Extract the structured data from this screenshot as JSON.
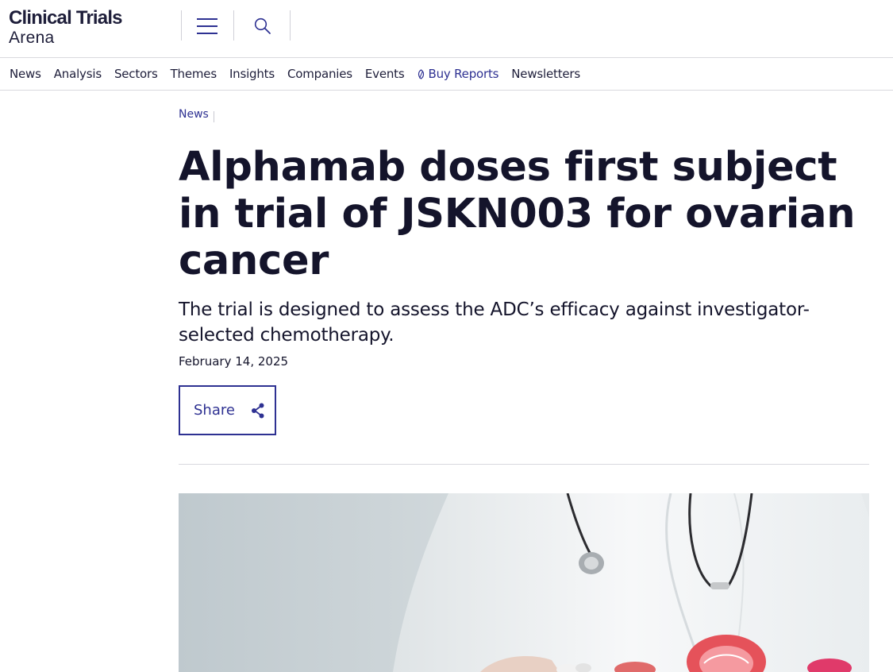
{
  "header": {
    "logo_line1": "Clinical Trials",
    "logo_line2": "Arena"
  },
  "icons": {
    "menu": "hamburger-menu-icon",
    "search": "search-icon",
    "share": "share-icon",
    "buy_reports": "leaf-icon"
  },
  "nav": {
    "items": [
      "News",
      "Analysis",
      "Sectors",
      "Themes",
      "Insights",
      "Companies",
      "Events",
      "Buy Reports",
      "Newsletters"
    ]
  },
  "article": {
    "category": "News",
    "title": "Alphamab doses first subject in trial of JSKN003 for ovarian cancer",
    "subtitle": "The trial is designed to assess the ADC’s efficacy against investigator-selected chemotherapy.",
    "date": "February 14, 2025",
    "share_label": "Share"
  },
  "colors": {
    "brand": "#2e3192",
    "text": "#14142b",
    "divider": "#d9d9de"
  }
}
